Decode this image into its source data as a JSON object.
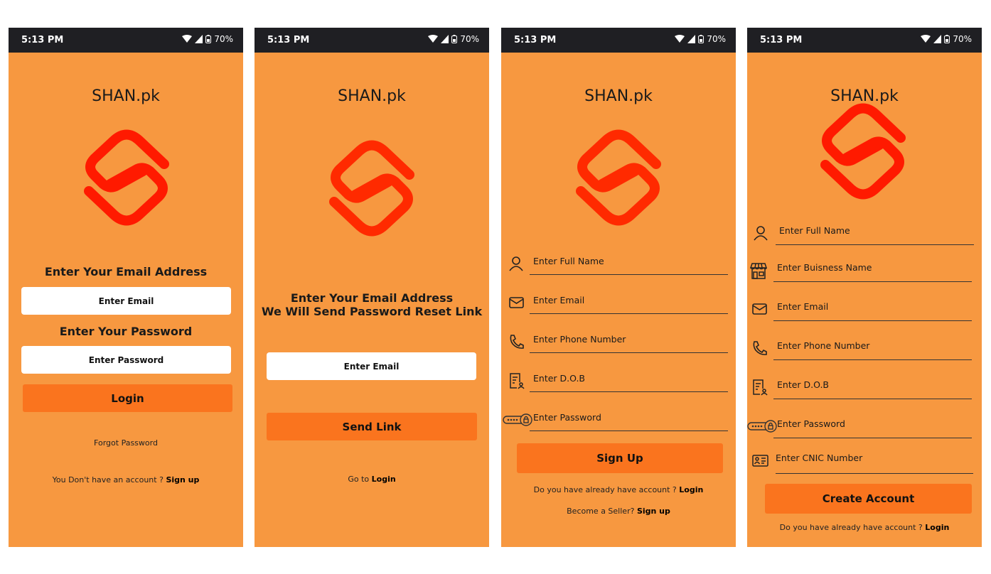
{
  "statusbar": {
    "time": "5:13 PM",
    "battery": "70%"
  },
  "brand": "SHAN.pk",
  "colors": {
    "background": "#f79840",
    "button": "#fa741e",
    "logo": "#ff1a00",
    "statusbar": "#1f1f23"
  },
  "login": {
    "email_heading": "Enter Your Email Address",
    "email_placeholder": "Enter Email",
    "password_heading": "Enter Your  Password",
    "password_placeholder": "Enter Password",
    "login_button": "Login",
    "forgot_password": "Forgot Password",
    "no_account_text": "You Don't have an account ?",
    "signup_link": "Sign up"
  },
  "reset": {
    "heading_line1": "Enter Your Email Address",
    "heading_line2": "We Will Send Password Reset Link",
    "email_placeholder": "Enter Email",
    "send_button": "Send Link",
    "goto_text": "Go to",
    "login_link": "Login"
  },
  "signup": {
    "fields": [
      {
        "label": "Enter Full Name",
        "icon": "user-icon"
      },
      {
        "label": "Enter Email",
        "icon": "mail-icon"
      },
      {
        "label": "Enter Phone Number",
        "icon": "phone-icon"
      },
      {
        "label": "Enter D.O.B",
        "icon": "document-user-icon"
      },
      {
        "label": "Enter Password",
        "icon": "password-lock-icon"
      }
    ],
    "signup_button": "Sign Up",
    "have_account_text": "Do you have already have account ?",
    "login_link": "Login",
    "seller_text": "Become a Seller?",
    "seller_link": "Sign up"
  },
  "seller": {
    "fields": [
      {
        "label": "Enter Full Name",
        "icon": "user-icon"
      },
      {
        "label": "Enter Buisness Name",
        "icon": "store-icon"
      },
      {
        "label": "Enter Email",
        "icon": "mail-icon"
      },
      {
        "label": "Enter Phone Number",
        "icon": "phone-icon"
      },
      {
        "label": "Enter D.O.B",
        "icon": "document-user-icon"
      },
      {
        "label": "Enter Password",
        "icon": "password-lock-icon"
      },
      {
        "label": "Enter CNIC Number",
        "icon": "id-card-icon"
      }
    ],
    "create_button": "Create Account",
    "have_account_text": "Do you have already have account ?",
    "login_link": "Login"
  }
}
